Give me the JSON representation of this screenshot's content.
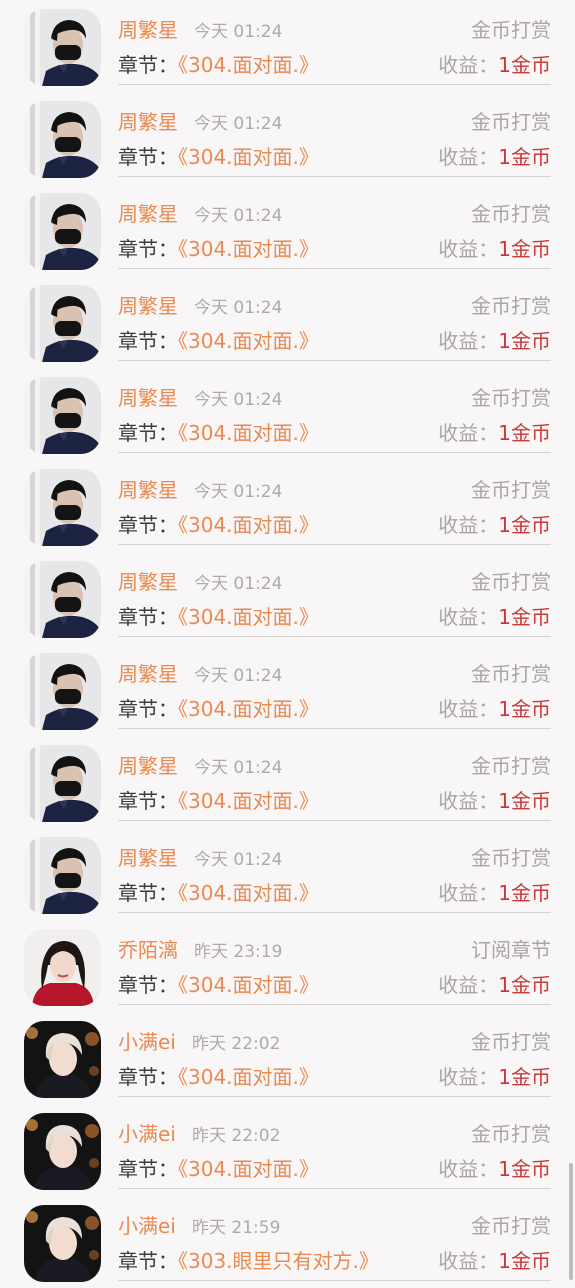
{
  "records": [
    {
      "name": "周繁星",
      "time": "今天 01:24",
      "type": "金币打赏",
      "chapter_label": "章节：",
      "chapter": "《304.面对面.》",
      "earn_label": "收益：",
      "earn_value": "1金币",
      "avatar": "masked-man"
    },
    {
      "name": "周繁星",
      "time": "今天 01:24",
      "type": "金币打赏",
      "chapter_label": "章节：",
      "chapter": "《304.面对面.》",
      "earn_label": "收益：",
      "earn_value": "1金币",
      "avatar": "masked-man"
    },
    {
      "name": "周繁星",
      "time": "今天 01:24",
      "type": "金币打赏",
      "chapter_label": "章节：",
      "chapter": "《304.面对面.》",
      "earn_label": "收益：",
      "earn_value": "1金币",
      "avatar": "masked-man"
    },
    {
      "name": "周繁星",
      "time": "今天 01:24",
      "type": "金币打赏",
      "chapter_label": "章节：",
      "chapter": "《304.面对面.》",
      "earn_label": "收益：",
      "earn_value": "1金币",
      "avatar": "masked-man"
    },
    {
      "name": "周繁星",
      "time": "今天 01:24",
      "type": "金币打赏",
      "chapter_label": "章节：",
      "chapter": "《304.面对面.》",
      "earn_label": "收益：",
      "earn_value": "1金币",
      "avatar": "masked-man"
    },
    {
      "name": "周繁星",
      "time": "今天 01:24",
      "type": "金币打赏",
      "chapter_label": "章节：",
      "chapter": "《304.面对面.》",
      "earn_label": "收益：",
      "earn_value": "1金币",
      "avatar": "masked-man"
    },
    {
      "name": "周繁星",
      "time": "今天 01:24",
      "type": "金币打赏",
      "chapter_label": "章节：",
      "chapter": "《304.面对面.》",
      "earn_label": "收益：",
      "earn_value": "1金币",
      "avatar": "masked-man"
    },
    {
      "name": "周繁星",
      "time": "今天 01:24",
      "type": "金币打赏",
      "chapter_label": "章节：",
      "chapter": "《304.面对面.》",
      "earn_label": "收益：",
      "earn_value": "1金币",
      "avatar": "masked-man"
    },
    {
      "name": "周繁星",
      "time": "今天 01:24",
      "type": "金币打赏",
      "chapter_label": "章节：",
      "chapter": "《304.面对面.》",
      "earn_label": "收益：",
      "earn_value": "1金币",
      "avatar": "masked-man"
    },
    {
      "name": "周繁星",
      "time": "今天 01:24",
      "type": "金币打赏",
      "chapter_label": "章节：",
      "chapter": "《304.面对面.》",
      "earn_label": "收益：",
      "earn_value": "1金币",
      "avatar": "masked-man"
    },
    {
      "name": "乔陌漓",
      "time": "昨天 23:19",
      "type": "订阅章节",
      "chapter_label": "章节：",
      "chapter": "《304.面对面.》",
      "earn_label": "收益：",
      "earn_value": "1金币",
      "avatar": "woman-red"
    },
    {
      "name": "小满ei",
      "time": "昨天 22:02",
      "type": "金币打赏",
      "chapter_label": "章节：",
      "chapter": "《304.面对面.》",
      "earn_label": "收益：",
      "earn_value": "1金币",
      "avatar": "blond-man"
    },
    {
      "name": "小满ei",
      "time": "昨天 22:02",
      "type": "金币打赏",
      "chapter_label": "章节：",
      "chapter": "《304.面对面.》",
      "earn_label": "收益：",
      "earn_value": "1金币",
      "avatar": "blond-man"
    },
    {
      "name": "小满ei",
      "time": "昨天 21:59",
      "type": "金币打赏",
      "chapter_label": "章节：",
      "chapter": "《303.眼里只有对方.》",
      "earn_label": "收益：",
      "earn_value": "1金币",
      "avatar": "blond-man"
    }
  ]
}
